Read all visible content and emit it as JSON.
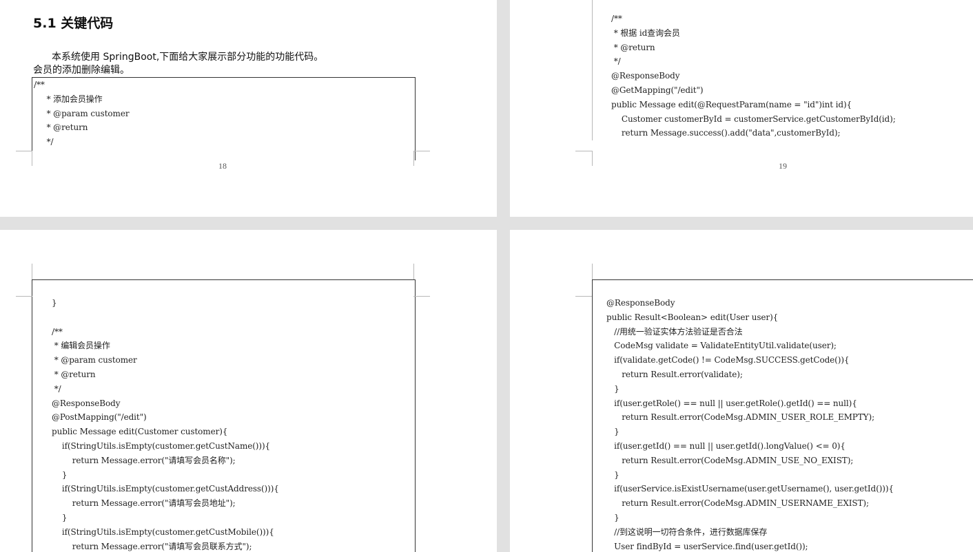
{
  "page1": {
    "heading": "5.1  关键代码",
    "intro": "本系统使用 SpringBoot,下面给大家展示部分功能的功能代码。",
    "subtitle": "会员的添加删除编辑。",
    "code": [
      "/**",
      "     * 添加会员操作",
      "     * @param customer",
      "     * @return",
      "     */"
    ],
    "page_number": "18"
  },
  "page2": {
    "code": [
      "/**",
      " * 根据 id查询会员",
      " * @return",
      " */",
      "@ResponseBody",
      "@GetMapping(\"/edit\")",
      "public Message edit(@RequestParam(name = \"id\")int id){",
      "    Customer customerById = customerService.getCustomerById(id);",
      "    return Message.success().add(\"data\",customerById);"
    ],
    "page_number": "19"
  },
  "page3": {
    "code": [
      "}",
      "",
      "/**",
      " * 编辑会员操作",
      " * @param customer",
      " * @return",
      " */",
      "@ResponseBody",
      "@PostMapping(\"/edit\")",
      "public Message edit(Customer customer){",
      "    if(StringUtils.isEmpty(customer.getCustName())){",
      "        return Message.error(\"请填写会员名称\");",
      "    }",
      "    if(StringUtils.isEmpty(customer.getCustAddress())){",
      "        return Message.error(\"请填写会员地址\");",
      "    }",
      "    if(StringUtils.isEmpty(customer.getCustMobile())){",
      "        return Message.error(\"请填写会员联系方式\");"
    ]
  },
  "page4": {
    "code": [
      "@ResponseBody",
      "public Result<Boolean> edit(User user){",
      "   //用统一验证实体方法验证是否合法",
      "   CodeMsg validate = ValidateEntityUtil.validate(user);",
      "   if(validate.getCode() != CodeMsg.SUCCESS.getCode()){",
      "      return Result.error(validate);",
      "   }",
      "   if(user.getRole() == null || user.getRole().getId() == null){",
      "      return Result.error(CodeMsg.ADMIN_USER_ROLE_EMPTY);",
      "   }",
      "   if(user.getId() == null || user.getId().longValue() <= 0){",
      "      return Result.error(CodeMsg.ADMIN_USE_NO_EXIST);",
      "   }",
      "   if(userService.isExistUsername(user.getUsername(), user.getId())){",
      "      return Result.error(CodeMsg.ADMIN_USERNAME_EXIST);",
      "   }",
      "   //到这说明一切符合条件，进行数据库保存",
      "   User findById = userService.find(user.getId());"
    ]
  }
}
